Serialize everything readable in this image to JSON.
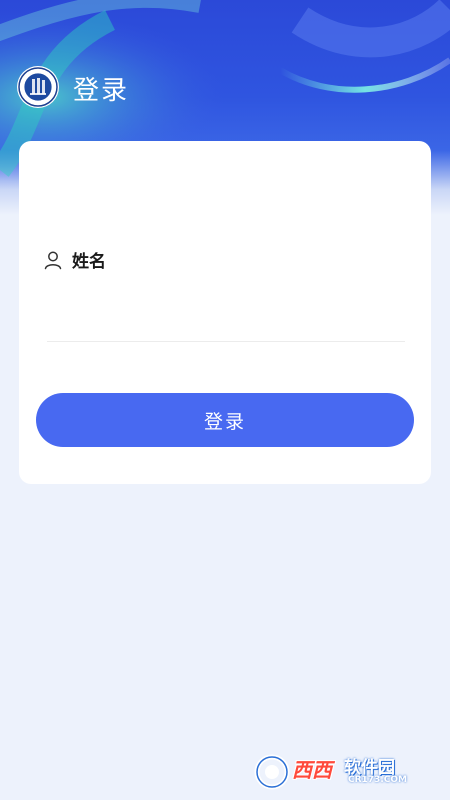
{
  "header": {
    "title": "登录",
    "logo_icon": "university-emblem-icon"
  },
  "login_form": {
    "name_label": "姓名",
    "name_icon": "user-icon",
    "name_value": "",
    "name_placeholder": "",
    "submit_label": "登录"
  },
  "watermark": {
    "main": "西西",
    "soft": "软件园",
    "domain": "CR173.COM"
  },
  "colors": {
    "header_blue": "#2f55e0",
    "accent": "#4869f1",
    "page_bg": "#edf2fc",
    "card_bg": "#ffffff"
  }
}
